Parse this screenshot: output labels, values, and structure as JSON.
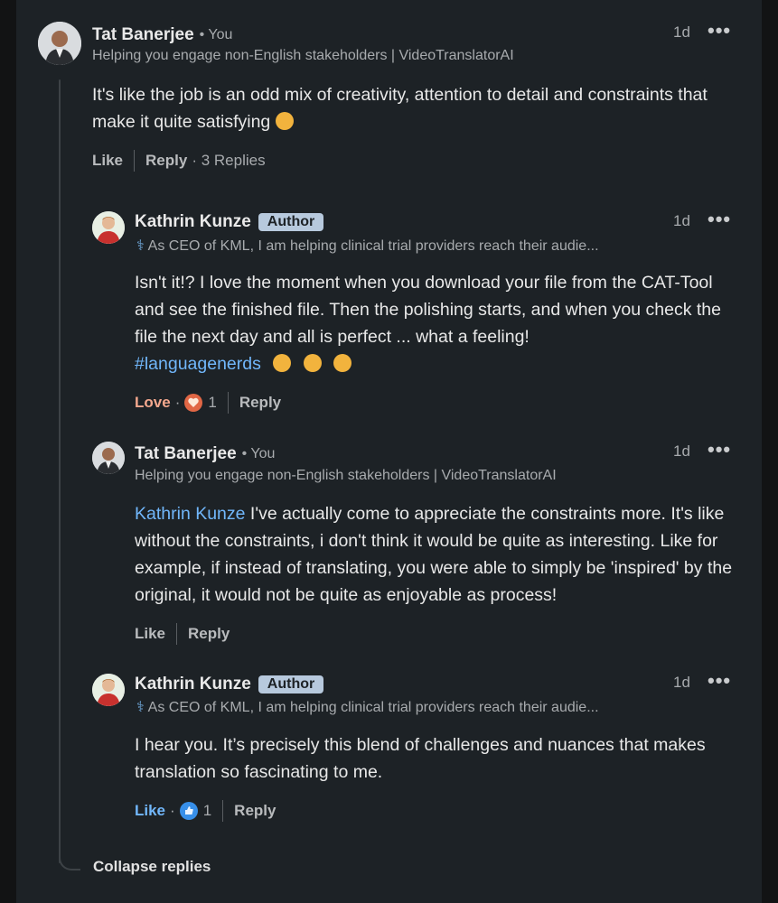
{
  "comments": [
    {
      "author": "Tat Banerjee",
      "you_tag": "• You",
      "headline": "Helping you engage non-English stakeholders | VideoTranslatorAI",
      "time": "1d",
      "text": "It's like the job is an odd mix of creativity, attention to detail and constraints that make it quite satisfying",
      "like_label": "Like",
      "reply_label": "Reply",
      "replies_count": "· 3 Replies"
    },
    {
      "author": "Kathrin Kunze",
      "badge": "Author",
      "headline_icon": "caduceus-icon",
      "headline": "As CEO of KML, I am helping clinical trial providers reach their audie...",
      "time": "1d",
      "text": "Isn't it!? I love the moment when you download your file from the CAT-Tool and see the finished file. Then the polishing starts, and when you check the file the next day and all is perfect ... what a feeling!",
      "hashtag": "#languagenerds",
      "reaction_label": "Love",
      "reaction_count": "1",
      "reply_label": "Reply"
    },
    {
      "author": "Tat Banerjee",
      "you_tag": "• You",
      "headline": "Helping you engage non-English stakeholders | VideoTranslatorAI",
      "time": "1d",
      "mention": "Kathrin Kunze",
      "text": "I've actually come to appreciate the constraints more. It's like without the constraints, i don't think it would be quite as interesting. Like for example, if instead of translating, you were able to simply be 'inspired' by the original, it would not be quite as enjoyable as process!",
      "like_label": "Like",
      "reply_label": "Reply"
    },
    {
      "author": "Kathrin Kunze",
      "badge": "Author",
      "headline_icon": "caduceus-icon",
      "headline": "As CEO of KML, I am helping clinical trial providers reach their audie...",
      "time": "1d",
      "text": "I hear you. It’s precisely this blend of challenges and nuances that makes translation so fascinating to me.",
      "reaction_label": "Like",
      "reaction_count": "1",
      "reply_label": "Reply"
    }
  ],
  "collapse_label": "Collapse replies",
  "more_glyph": "•••",
  "caduceus_glyph": "⚕",
  "colors": {
    "background": "#1d2226",
    "link": "#71b7fb",
    "love": "#f4a88e",
    "badge": "#b7c9dd"
  }
}
